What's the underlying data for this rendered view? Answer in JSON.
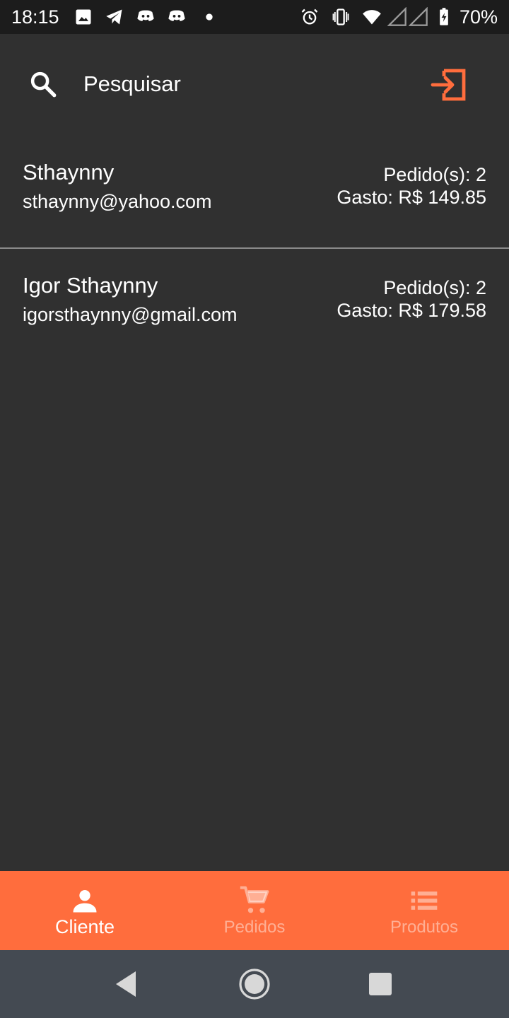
{
  "status_bar": {
    "time": "18:15",
    "battery_percent": "70%",
    "left_icons": [
      "image-icon",
      "telegram-icon",
      "discord-icon",
      "discord-icon",
      "dot-icon"
    ],
    "right_icons": [
      "alarm-icon",
      "vibrate-icon",
      "wifi-icon",
      "signal-icon",
      "signal-icon",
      "battery-charging-icon"
    ]
  },
  "search": {
    "placeholder": "Pesquisar",
    "icon": "search-icon"
  },
  "header": {
    "logout_icon": "logout-icon",
    "accent_color": "#ff6d3d"
  },
  "clients": [
    {
      "name": "Sthaynny",
      "email": "sthaynny@yahoo.com",
      "orders": "Pedido(s): 2",
      "spent": "Gasto: R$ 149.85"
    },
    {
      "name": "Igor Sthaynny",
      "email": "igorsthaynny@gmail.com",
      "orders": "Pedido(s): 2",
      "spent": "Gasto: R$ 179.58"
    }
  ],
  "bottom_nav": {
    "tabs": [
      {
        "label": "Cliente",
        "icon": "person-icon",
        "active": true
      },
      {
        "label": "Pedidos",
        "icon": "cart-icon",
        "active": false
      },
      {
        "label": "Produtos",
        "icon": "list-icon",
        "active": false
      }
    ],
    "background_color": "#ff6d3d"
  },
  "system_nav": {
    "buttons": [
      "back-icon",
      "home-icon",
      "recents-icon"
    ]
  }
}
